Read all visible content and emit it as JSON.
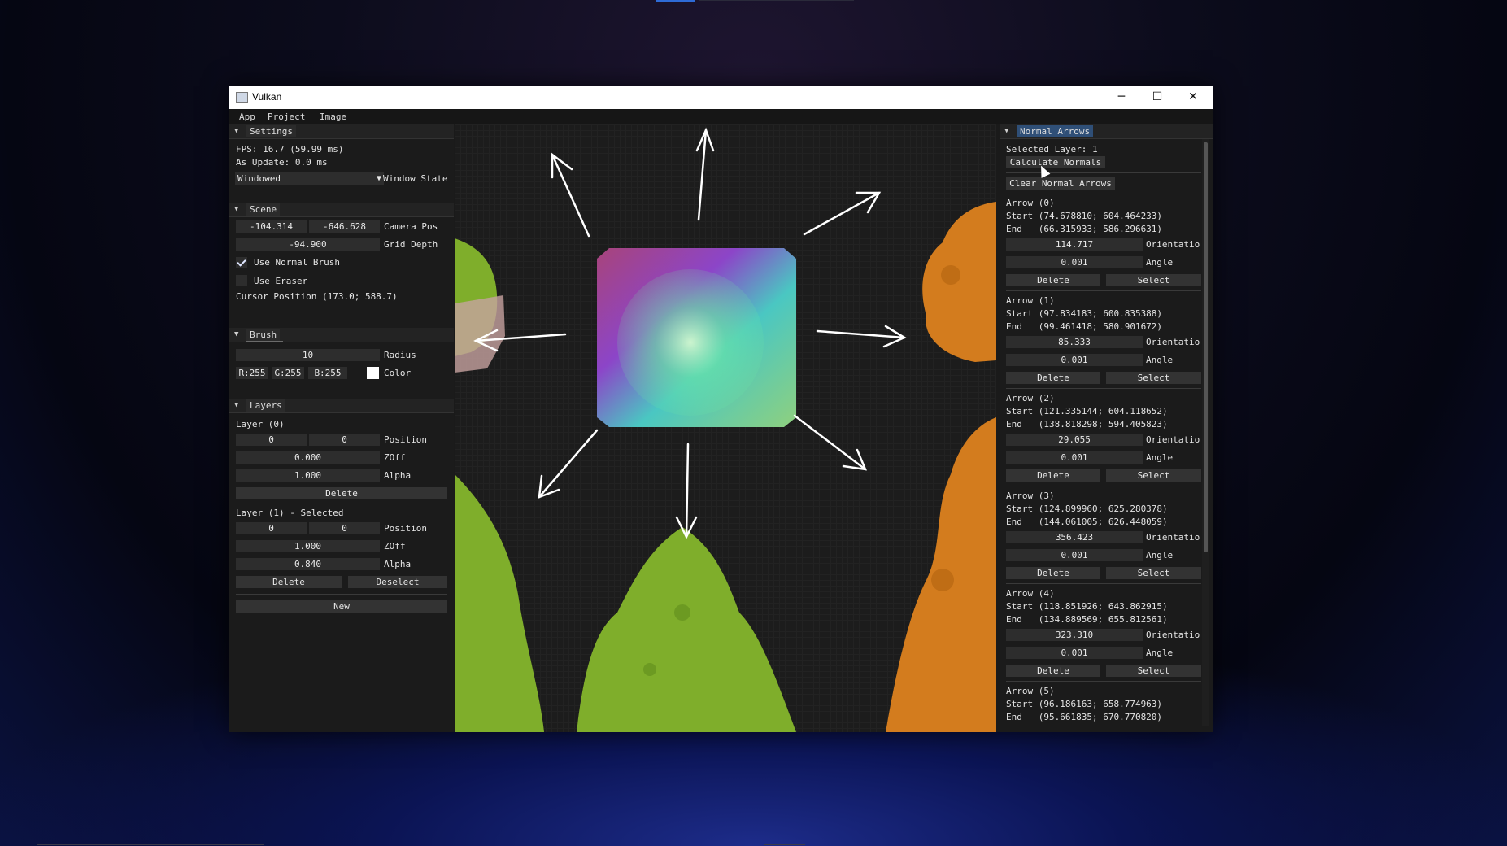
{
  "window": {
    "title": "Vulkan",
    "minimize": "─",
    "maximize": "☐",
    "close": "✕"
  },
  "menu": [
    "App",
    "Project",
    "Image"
  ],
  "settings": {
    "header": "Settings",
    "fps": "FPS: 16.7 (59.99 ms)",
    "as_update": "As Update: 0.0 ms",
    "window_state_value": "Windowed",
    "window_state_label": "Window State"
  },
  "scene": {
    "header": "Scene",
    "camera_x": "-104.314",
    "camera_y": "-646.628",
    "camera_label": "Camera Pos",
    "grid_depth": "-94.900",
    "grid_label": "Grid Depth",
    "use_normal_brush": "Use Normal Brush",
    "use_normal_brush_checked": true,
    "use_eraser": "Use Eraser",
    "use_eraser_checked": false,
    "cursor_position": "Cursor Position (173.0; 588.7)"
  },
  "brush": {
    "header": "Brush",
    "radius": "10",
    "radius_label": "Radius",
    "r": "R:255",
    "g": "G:255",
    "b": "B:255",
    "color_label": "Color",
    "color": "#ffffff"
  },
  "layers": {
    "header": "Layers",
    "items": [
      {
        "title": "Layer (0)",
        "pos_x": "0",
        "pos_y": "0",
        "pos_label": "Position",
        "zoff": "0.000",
        "zoff_label": "ZOff",
        "alpha": "1.000",
        "alpha_label": "Alpha",
        "delete": "Delete"
      },
      {
        "title": "Layer (1) - Selected",
        "pos_x": "0",
        "pos_y": "0",
        "pos_label": "Position",
        "zoff": "1.000",
        "zoff_label": "ZOff",
        "alpha": "0.840",
        "alpha_label": "Alpha",
        "delete": "Delete",
        "deselect": "Deselect"
      }
    ],
    "new": "New"
  },
  "normal_arrows": {
    "header": "Normal Arrows",
    "selected_layer": "Selected Layer: 1",
    "calculate": "Calculate Normals",
    "clear": "Clear Normal Arrows",
    "arrows": [
      {
        "title": "Arrow (0)",
        "start": "Start (74.678810; 604.464233)",
        "end": "End   (66.315933; 586.296631)",
        "orientation": "114.717",
        "angle": "0.001"
      },
      {
        "title": "Arrow (1)",
        "start": "Start (97.834183; 600.835388)",
        "end": "End   (99.461418; 580.901672)",
        "orientation": "85.333",
        "angle": "0.001"
      },
      {
        "title": "Arrow (2)",
        "start": "Start (121.335144; 604.118652)",
        "end": "End   (138.818298; 594.405823)",
        "orientation": "29.055",
        "angle": "0.001"
      },
      {
        "title": "Arrow (3)",
        "start": "Start (124.899960; 625.280378)",
        "end": "End   (144.061005; 626.448059)",
        "orientation": "356.423",
        "angle": "0.001"
      },
      {
        "title": "Arrow (4)",
        "start": "Start (118.851926; 643.862915)",
        "end": "End   (134.889569; 655.812561)",
        "orientation": "323.310",
        "angle": "0.001"
      },
      {
        "title": "Arrow (5)",
        "start": "Start (96.186163; 658.774963)",
        "end": "End   (95.661835; 670.770820)"
      }
    ],
    "orientation_label": "Orientatio",
    "angle_label": "Angle",
    "delete": "Delete",
    "select": "Select"
  },
  "colors": {
    "green": "#7fae2b",
    "orange": "#d37c1e",
    "accent": "#2f4f77"
  }
}
